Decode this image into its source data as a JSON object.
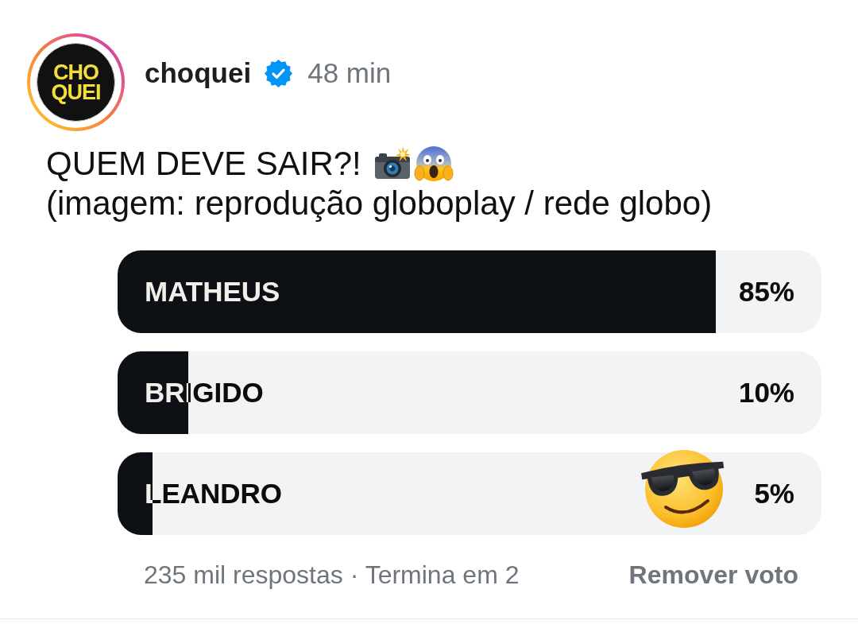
{
  "post": {
    "author": {
      "avatar_logo": [
        "CHO",
        "QUEI"
      ],
      "name": "choquei",
      "verified": true,
      "time": "48 min"
    },
    "text_lines": [
      "QUEM DEVE SAIR?!",
      "(imagem: reprodução globoplay / rede globo)"
    ]
  },
  "poll": {
    "options": [
      {
        "label": "MATHEUS",
        "percent": "85%",
        "level": 0.85
      },
      {
        "label": "BRIGIDO",
        "percent": "10%",
        "level": 0.1
      },
      {
        "label": "LEANDRO",
        "percent": "5%",
        "level": 0.05
      }
    ],
    "summary": "235 mil respostas · Termina em 2",
    "remove_vote": "Remover voto"
  }
}
